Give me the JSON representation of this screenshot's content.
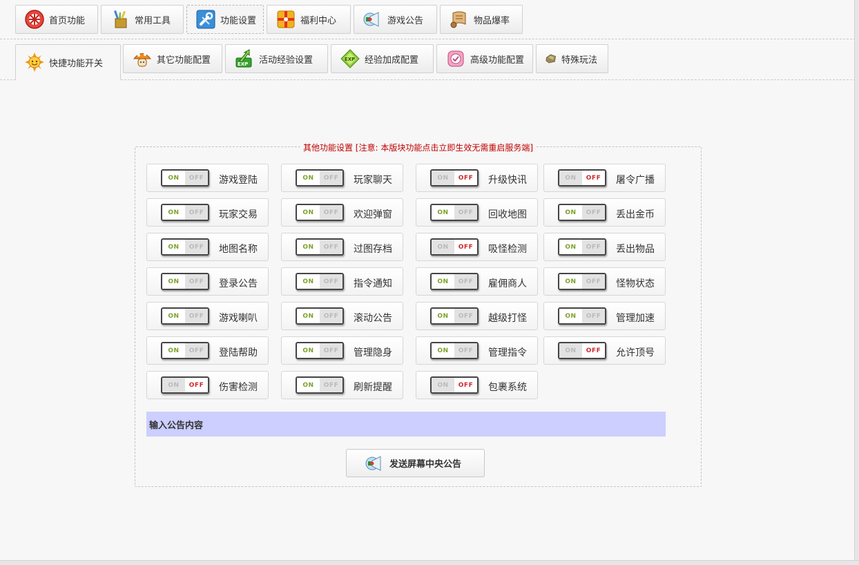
{
  "main_tabs": [
    {
      "label": "首页功能",
      "icon": "home-swirl-icon",
      "active": false
    },
    {
      "label": "常用工具",
      "icon": "toolbox-icon",
      "active": false
    },
    {
      "label": "功能设置",
      "icon": "wrench-icon",
      "active": true
    },
    {
      "label": "福利中心",
      "icon": "gift-icon",
      "active": false
    },
    {
      "label": "游戏公告",
      "icon": "megaphone-icon",
      "active": false
    },
    {
      "label": "物品爆率",
      "icon": "scroll-icon",
      "active": false
    }
  ],
  "sub_tabs": [
    {
      "label": "快捷功能开关",
      "icon": "sun-icon",
      "active": true
    },
    {
      "label": "其它功能配置",
      "icon": "mushroom-icon",
      "active": false
    },
    {
      "label": "活动经验设置",
      "icon": "exp-arrow-icon",
      "active": false
    },
    {
      "label": "经验加成配置",
      "icon": "exp-diamond-icon",
      "active": false
    },
    {
      "label": "高级功能配置",
      "icon": "pink-badge-icon",
      "active": false
    },
    {
      "label": "特殊玩法",
      "icon": "stone-icon",
      "active": false
    }
  ],
  "panel": {
    "legend": "其他功能设置 [注意: 本版块功能点击立即生效无需重启服务端]",
    "toggle_on_text": "ON",
    "toggle_off_text": "OFF",
    "switches": [
      {
        "label": "游戏登陆",
        "state": "on"
      },
      {
        "label": "玩家聊天",
        "state": "on"
      },
      {
        "label": "升级快讯",
        "state": "off"
      },
      {
        "label": "屠令广播",
        "state": "off"
      },
      {
        "label": "玩家交易",
        "state": "on"
      },
      {
        "label": "欢迎弹窗",
        "state": "on"
      },
      {
        "label": "回收地图",
        "state": "on"
      },
      {
        "label": "丢出金币",
        "state": "on"
      },
      {
        "label": "地图名称",
        "state": "on"
      },
      {
        "label": "过图存档",
        "state": "on"
      },
      {
        "label": "吸怪检测",
        "state": "off"
      },
      {
        "label": "丢出物品",
        "state": "on"
      },
      {
        "label": "登录公告",
        "state": "on"
      },
      {
        "label": "指令通知",
        "state": "on"
      },
      {
        "label": "雇佣商人",
        "state": "on"
      },
      {
        "label": "怪物状态",
        "state": "on"
      },
      {
        "label": "游戏喇叭",
        "state": "on"
      },
      {
        "label": "滚动公告",
        "state": "on"
      },
      {
        "label": "越级打怪",
        "state": "on"
      },
      {
        "label": "管理加速",
        "state": "on"
      },
      {
        "label": "登陆帮助",
        "state": "on"
      },
      {
        "label": "管理隐身",
        "state": "on"
      },
      {
        "label": "管理指令",
        "state": "on"
      },
      {
        "label": "允许顶号",
        "state": "off"
      },
      {
        "label": "伤害检测",
        "state": "off"
      },
      {
        "label": "刷新提醒",
        "state": "on"
      },
      {
        "label": "包裹系统",
        "state": "off"
      }
    ],
    "notice_label": "输入公告内容",
    "send_button": {
      "label": "发送屏幕中央公告",
      "icon": "megaphone-icon"
    }
  },
  "colors": {
    "on_text": "#7ca12a",
    "off_text": "#d0262b",
    "legend_text": "#c00000",
    "notice_bg": "#cccfff"
  }
}
